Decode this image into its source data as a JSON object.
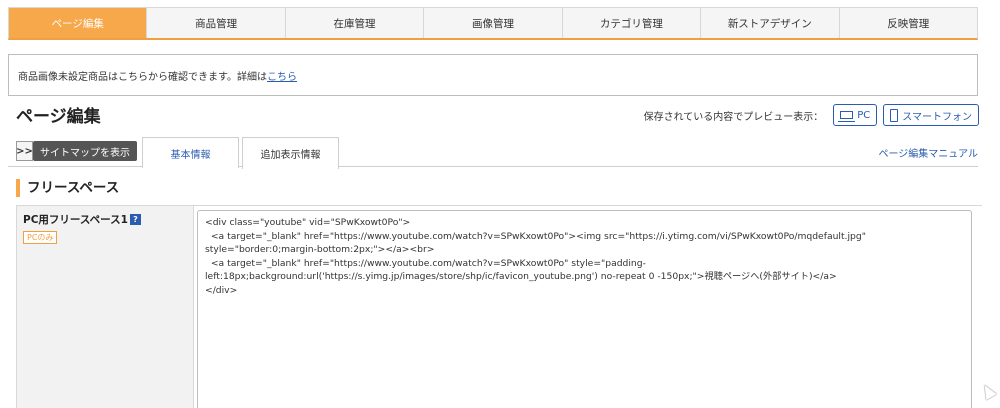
{
  "nav": {
    "tabs": [
      "ページ編集",
      "商品管理",
      "在庫管理",
      "画像管理",
      "カテゴリ管理",
      "新ストアデザイン",
      "反映管理"
    ],
    "active_index": 0
  },
  "notice": {
    "text": "商品画像未設定商品はこちらから確認できます。詳細は",
    "link": "こちら"
  },
  "page_title": "ページ編集",
  "preview": {
    "label": "保存されている内容でプレビュー表示：",
    "pc_label": "PC",
    "sp_label": "スマートフォン"
  },
  "subtabs": {
    "sitemap_arrow": ">>",
    "sitemap_tooltip": "サイトマップを表示",
    "basic": "基本情報",
    "extra": "追加表示情報",
    "manual": "ページ編集マニュアル"
  },
  "section_title": "フリースペース",
  "field": {
    "label": "PC用フリースペース1",
    "help": "?",
    "badge": "PCのみ",
    "value": "<div class=\"youtube\" vid=\"SPwKxowt0Po\">\n  <a target=\"_blank\" href=\"https://www.youtube.com/watch?v=SPwKxowt0Po\"><img src=\"https://i.ytimg.com/vi/SPwKxowt0Po/mqdefault.jpg\" style=\"border:0;margin-bottom:2px;\"></a><br>\n  <a target=\"_blank\" href=\"https://www.youtube.com/watch?v=SPwKxowt0Po\" style=\"padding-left:18px;background:url('https://s.yimg.jp/images/store/shp/ic/favicon_youtube.png') no-repeat 0 -150px;\">視聴ページへ(外部サイト)</a>\n</div>"
  },
  "colors": {
    "accent": "#f7a84b",
    "link": "#2a5db0"
  }
}
